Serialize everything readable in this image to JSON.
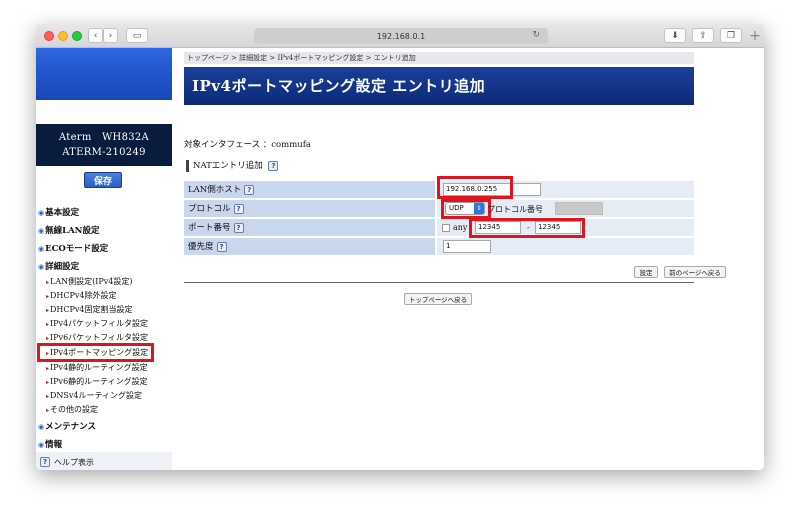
{
  "browser": {
    "address": "192.168.0.1"
  },
  "sidebar": {
    "model_line1": "Aterm　WH832A",
    "model_line2": "ATERM-210249",
    "save_label": "保存",
    "nav": [
      {
        "label": "基本設定"
      },
      {
        "label": "無線LAN設定"
      },
      {
        "label": "ECOモード設定"
      },
      {
        "label": "詳細設定"
      }
    ],
    "sub_items": [
      "LAN側設定(IPv4設定)",
      "DHCPv4除外設定",
      "DHCPv4固定割当設定",
      "IPv4パケットフィルタ設定",
      "IPv6パケットフィルタ設定",
      "IPv4ポートマッピング設定",
      "IPv4静的ルーティング設定",
      "IPv6静的ルーティング設定",
      "DNSv4ルーティング設定",
      "その他の設定"
    ],
    "nav_bottom": [
      {
        "label": "メンテナンス"
      },
      {
        "label": "情報"
      }
    ],
    "help_label": "ヘルプ表示"
  },
  "main": {
    "breadcrumb": "トップページ > 詳細設定 > IPv4ポートマッピング設定 > エントリ追加",
    "title": "IPv4ポートマッピング設定 エントリ追加",
    "interface_label": "対象インタフェース ：commufa",
    "nat_heading": "NATエントリ追加",
    "rows": {
      "lan_host": {
        "label": "LAN側ホスト",
        "value": "192.168.0.255"
      },
      "protocol": {
        "label": "プロトコル",
        "value": "UDP",
        "protocol_number_label": "プロトコル番号"
      },
      "port": {
        "label": "ポート番号",
        "any_label": "any",
        "from": "12345",
        "sep": "-",
        "to": "12345"
      },
      "priority": {
        "label": "優先度",
        "value": "1"
      }
    },
    "set_button": "設定",
    "back_button": "前のページへ戻る",
    "top_button": "トップページへ戻る"
  }
}
